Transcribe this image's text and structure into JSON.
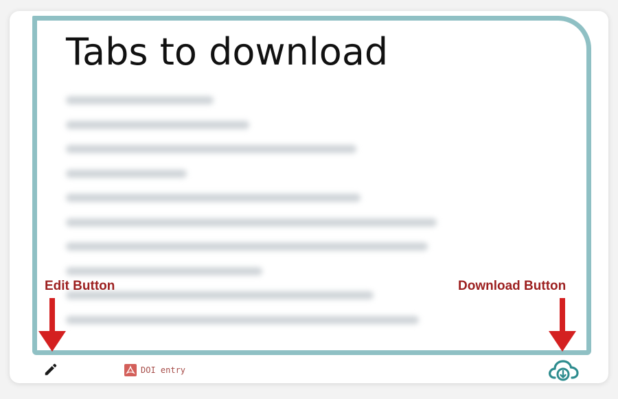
{
  "card": {
    "title": "Tabs to download",
    "tabs_count_note": "",
    "blurred_tab_widths": [
      0.33,
      0.41,
      0.65,
      0.27,
      0.66,
      0.83,
      0.81,
      0.44,
      0.69,
      0.79
    ]
  },
  "footer": {
    "edit_icon": "pencil-icon",
    "pdf_icon": "pdf-icon",
    "pdf_label": "DOI entry",
    "download_icon": "cloud-download-icon"
  },
  "annotations": {
    "edit_label": "Edit Button",
    "download_label": "Download Button"
  },
  "colors": {
    "frame": "#8fc0c4",
    "annotation": "#9c1f1f",
    "arrow": "#d42020",
    "download_icon": "#2d8c8e",
    "pdf": "#d35f5a"
  }
}
